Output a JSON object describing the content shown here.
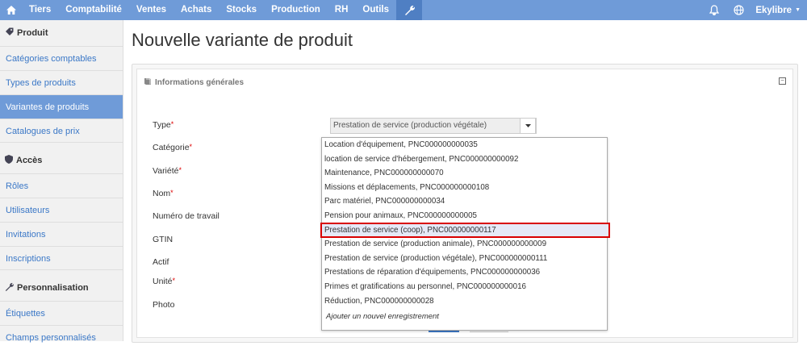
{
  "topnav": {
    "home_icon": "home-icon",
    "items": [
      "Tiers",
      "Comptabilité",
      "Ventes",
      "Achats",
      "Stocks",
      "Production",
      "RH",
      "Outils"
    ],
    "tools_icon": "wrench-icon",
    "bell_icon": "bell-icon",
    "globe_icon": "globe-icon",
    "user": "Ekylibre",
    "colors": {
      "bar": "#6f9bd8",
      "active": "#4f7fc3"
    }
  },
  "sidebar": {
    "sections": [
      {
        "title": "Produit",
        "icon": "tag-icon",
        "items": [
          "Catégories comptables",
          "Types de produits",
          "Variantes de produits",
          "Catalogues de prix"
        ]
      },
      {
        "title": "Accès",
        "icon": "shield-icon",
        "items": [
          "Rôles",
          "Utilisateurs",
          "Invitations",
          "Inscriptions"
        ]
      },
      {
        "title": "Personnalisation",
        "icon": "wrench-icon",
        "items": [
          "Étiquettes",
          "Champs personnalisés"
        ]
      }
    ],
    "active_item": "Variantes de produits"
  },
  "main": {
    "title": "Nouvelle variante de produit",
    "section_title": "Informations générales",
    "section_icon": "book-icon",
    "fields": {
      "type": "Type",
      "categorie": "Catégorie",
      "variete": "Variété",
      "nom": "Nom",
      "numero": "Numéro de travail",
      "gtin": "GTIN",
      "actif": "Actif",
      "unite": "Unité",
      "photo": "Photo"
    },
    "required_mark": "*",
    "type_value": "Prestation de service (production végétale)",
    "categorie_value": ""
  },
  "dropdown": {
    "items": [
      "Location d'équipement, PNC000000000035",
      "location de service d'hébergement, PNC000000000092",
      "Maintenance, PNC000000000070",
      "Missions et déplacements, PNC000000000108",
      "Parc matériel, PNC000000000034",
      "Pension pour animaux, PNC000000000005",
      "Prestation de service (coop), PNC000000000117",
      "Prestation de service (production animale), PNC000000000009",
      "Prestation de service (production végétale), PNC000000000111",
      "Prestations de réparation d'équipements, PNC000000000036",
      "Primes et gratifications au personnel, PNC000000000016",
      "Réduction, PNC000000000028"
    ],
    "highlighted": "Prestation de service (coop), PNC000000000117",
    "add_label": "Ajouter un nouvel enregistrement",
    "highlight_color": "#d90000"
  }
}
